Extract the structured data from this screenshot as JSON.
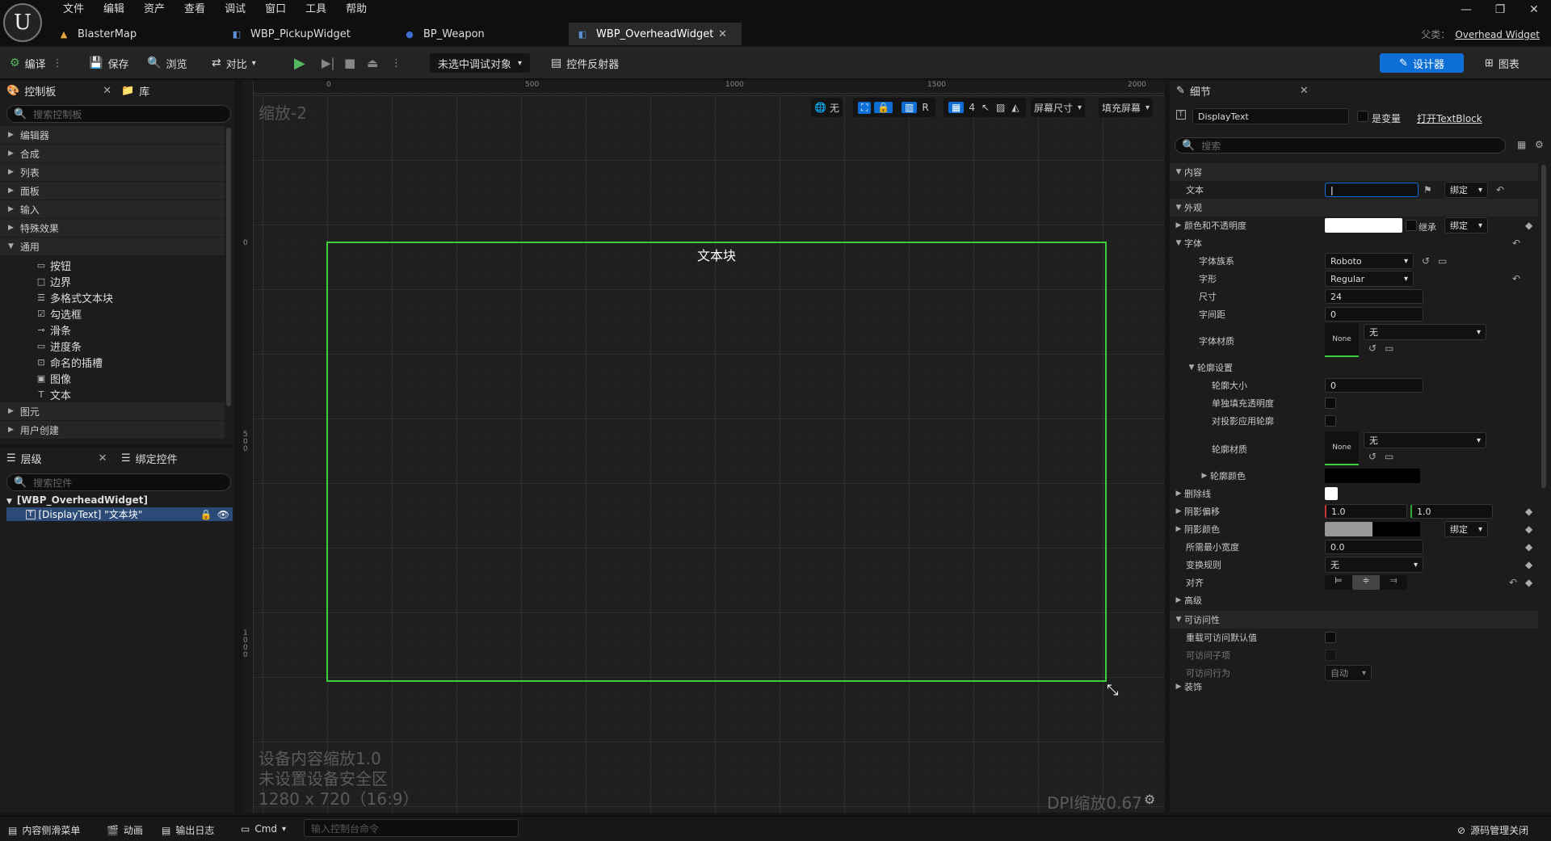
{
  "menu": [
    "文件",
    "编辑",
    "资产",
    "查看",
    "调试",
    "窗口",
    "工具",
    "帮助"
  ],
  "tabs": [
    {
      "label": "BlasterMap"
    },
    {
      "label": "WBP_PickupWidget"
    },
    {
      "label": "BP_Weapon"
    },
    {
      "label": "WBP_OverheadWidget"
    }
  ],
  "window": {
    "parent_label": "父类：",
    "parent_value": "Overhead Widget"
  },
  "toolbar": {
    "compile": "编译",
    "save": "保存",
    "browse": "浏览",
    "diff": "对比",
    "debug_target": "未选中调试对象",
    "widget_reflector": "控件反射器",
    "designer": "设计器",
    "graph": "图表"
  },
  "palette": {
    "tab": "控制板",
    "library_tab": "库",
    "search_placeholder": "搜索控制板",
    "categories": [
      "编辑器",
      "合成",
      "列表",
      "面板",
      "输入",
      "特殊效果",
      "通用"
    ],
    "common_items": [
      "按钮",
      "边界",
      "多格式文本块",
      "勾选框",
      "滑条",
      "进度条",
      "命名的插槽",
      "图像",
      "文本"
    ],
    "bottom_categories": [
      "图元",
      "用户创建"
    ]
  },
  "hierarchy": {
    "tab": "层级",
    "bind_tab": "绑定控件",
    "search_placeholder": "搜索控件",
    "root": "[WBP_OverheadWidget]",
    "child": "[DisplayText] \"文本块\""
  },
  "canvas": {
    "zoom_label": "缩放-2",
    "ruler_top": [
      "0",
      "500",
      "1000",
      "1500",
      "2000"
    ],
    "ruler_left": [
      "0",
      "500",
      "1000"
    ],
    "controls": {
      "none": "无",
      "r": "R",
      "grid_num": "4",
      "screen_size": "屏幕尺寸",
      "fill_screen": "填充屏幕"
    },
    "text_block": "文本块",
    "device_lines": [
      "设备内容缩放1.0",
      "未设置设备安全区",
      "1280 x 720（16:9）"
    ],
    "dpi": "DPI缩放0.67"
  },
  "details": {
    "tab": "细节",
    "name": "DisplayText",
    "is_variable": "是变量",
    "open_textblock": "打开TextBlock",
    "search_placeholder": "搜索",
    "content": "内容",
    "text_label": "文本",
    "bind": "绑定",
    "appearance": "外观",
    "color_opacity": "颜色和不透明度",
    "inherit": "继承",
    "font": "字体",
    "font_family": "字体族系",
    "font_family_value": "Roboto",
    "typeface": "字形",
    "typeface_value": "Regular",
    "size": "尺寸",
    "size_value": "24",
    "letter_spacing": "字间距",
    "letter_spacing_value": "0",
    "font_material": "字体材质",
    "none_value": "无",
    "none_thumb": "None",
    "outline_settings": "轮廓设置",
    "outline_size": "轮廓大小",
    "outline_size_value": "0",
    "separate_fill_alpha": "单独填充透明度",
    "apply_outline_shadow": "对投影应用轮廓",
    "outline_material": "轮廓材质",
    "outline_color": "轮廓颜色",
    "strikethrough": "删除线",
    "shadow_offset": "阴影偏移",
    "shadow_x": "1.0",
    "shadow_y": "1.0",
    "shadow_color": "阴影颜色",
    "min_width": "所需最小宽度",
    "min_width_value": "0.0",
    "transform_policy": "变换规则",
    "transform_value": "无",
    "justification": "对齐",
    "advanced": "高级",
    "accessibility": "可访问性",
    "override_default": "重载可访问默认值",
    "access_children": "可访问子项",
    "access_behavior": "可访问行为",
    "auto": "自动",
    "extra": "装饰"
  },
  "status": {
    "content_drawer": "内容侧滑菜单",
    "animation": "动画",
    "output_log": "输出日志",
    "cmd": "Cmd",
    "cmd_placeholder": "输入控制台命令",
    "source_control": "源码管理关闭"
  },
  "colors": {
    "accent": "#0d6fd6",
    "selection": "#3ccd3c",
    "play": "#55b85f"
  }
}
